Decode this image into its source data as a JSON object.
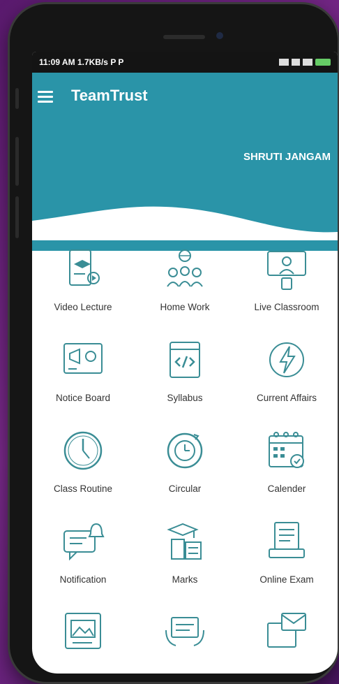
{
  "status_bar": {
    "time": "11:09 AM",
    "speed": "1.7KB/s",
    "extra": "P  P"
  },
  "header": {
    "app_title": "TeamTrust",
    "user_name": "SHRUTI JANGAM"
  },
  "colors": {
    "primary": "#2a94a8",
    "icon": "#3a8d95",
    "background": "#ffffff"
  },
  "menu": [
    {
      "label": "Video Lecture",
      "icon": "video-lecture-icon"
    },
    {
      "label": "Home Work",
      "icon": "home-work-icon"
    },
    {
      "label": "Live Classroom",
      "icon": "live-classroom-icon"
    },
    {
      "label": "Notice Board",
      "icon": "notice-board-icon"
    },
    {
      "label": "Syllabus",
      "icon": "syllabus-icon"
    },
    {
      "label": "Current Affairs",
      "icon": "current-affairs-icon"
    },
    {
      "label": "Class Routine",
      "icon": "class-routine-icon"
    },
    {
      "label": "Circular",
      "icon": "circular-icon"
    },
    {
      "label": "Calender",
      "icon": "calender-icon"
    },
    {
      "label": "Notification",
      "icon": "notification-icon"
    },
    {
      "label": "Marks",
      "icon": "marks-icon"
    },
    {
      "label": "Online Exam",
      "icon": "online-exam-icon"
    },
    {
      "label": "",
      "icon": "gallery-icon"
    },
    {
      "label": "",
      "icon": "tablet-icon"
    },
    {
      "label": "",
      "icon": "mail-icon"
    }
  ]
}
